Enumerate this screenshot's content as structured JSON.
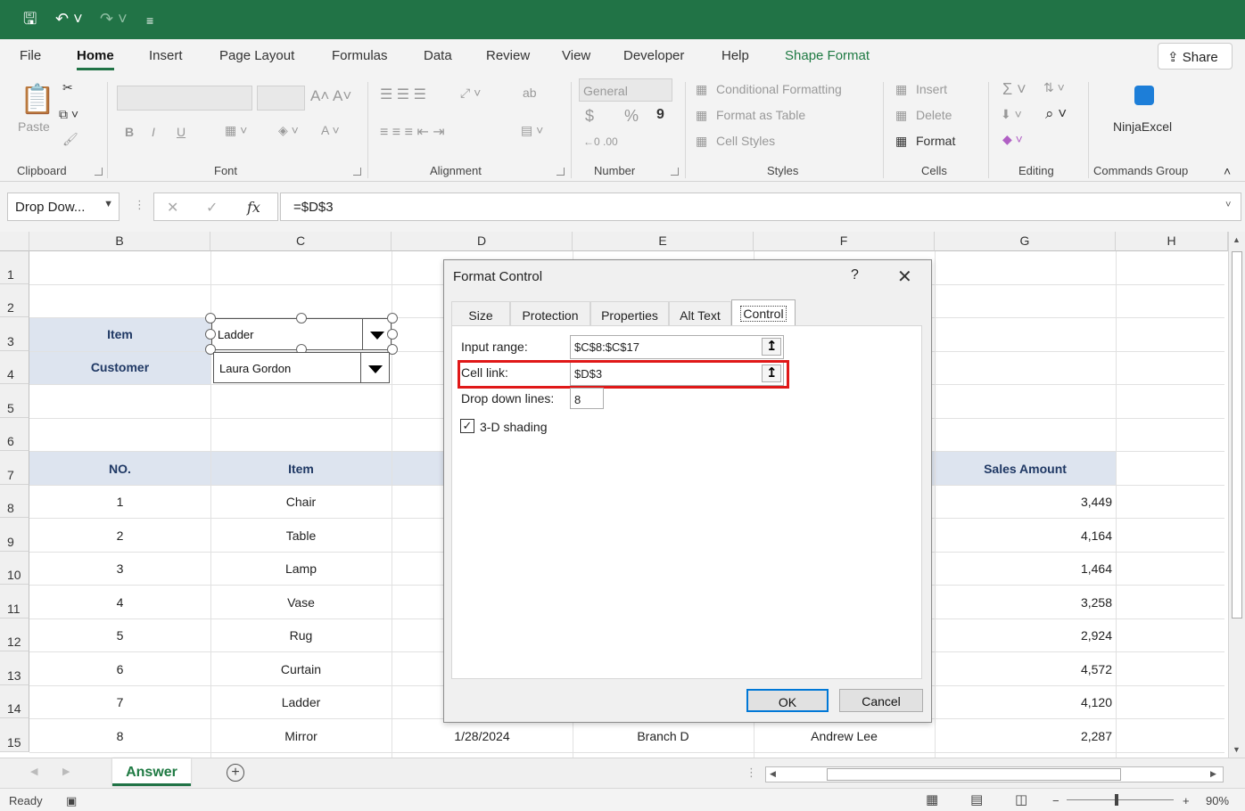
{
  "quick_access": {
    "save_icon": "save-icon",
    "undo_icon": "undo-icon",
    "redo_icon": "redo-icon",
    "customize_icon": "customize-icon"
  },
  "ribbon_tabs": [
    "File",
    "Home",
    "Insert",
    "Page Layout",
    "Formulas",
    "Data",
    "Review",
    "View",
    "Developer",
    "Help",
    "Shape Format"
  ],
  "share_label": "Share",
  "ribbon": {
    "clipboard": {
      "paste": "Paste",
      "label": "Clipboard"
    },
    "font": {
      "label": "Font",
      "bold": "B",
      "italic": "I",
      "underline": "U"
    },
    "alignment": {
      "label": "Alignment"
    },
    "number": {
      "format": "General",
      "currency": "$",
      "percent": "%",
      "comma": "9",
      "label": "Number"
    },
    "styles": {
      "conditional": "Conditional Formatting",
      "format_table": "Format as Table",
      "cell_styles": "Cell Styles",
      "label": "Styles"
    },
    "cells": {
      "insert": "Insert",
      "delete": "Delete",
      "format": "Format",
      "label": "Cells"
    },
    "editing": {
      "label": "Editing"
    },
    "commands": {
      "ninja": "NinjaExcel",
      "label": "Commands Group"
    }
  },
  "formula_bar": {
    "name_box": "Drop Dow...",
    "formula": "=$D$3",
    "fx": "fx"
  },
  "columns": [
    "B",
    "C",
    "D",
    "E",
    "F",
    "G",
    "H"
  ],
  "rows": [
    "1",
    "2",
    "3",
    "4",
    "5",
    "6",
    "7",
    "8",
    "9",
    "10",
    "11",
    "12",
    "13",
    "14",
    "15"
  ],
  "sheet": {
    "item_label": "Item",
    "customer_label": "Customer",
    "item_combo_value": "Ladder",
    "customer_combo_value": "Laura Gordon",
    "table_headers": {
      "no": "NO.",
      "item": "Item",
      "sales": "Sales Amount"
    },
    "table_rows": [
      {
        "no": "1",
        "item": "Chair",
        "sales": "3,449"
      },
      {
        "no": "2",
        "item": "Table",
        "sales": "4,164"
      },
      {
        "no": "3",
        "item": "Lamp",
        "sales": "1,464"
      },
      {
        "no": "4",
        "item": "Vase",
        "sales": "3,258"
      },
      {
        "no": "5",
        "item": "Rug",
        "sales": "2,924"
      },
      {
        "no": "6",
        "item": "Curtain",
        "sales": "4,572"
      },
      {
        "no": "7",
        "item": "Ladder",
        "sales": "4,120"
      },
      {
        "no": "8",
        "item": "Mirror",
        "sales": "2,287",
        "date": "1/28/2024",
        "branch": "Branch D",
        "customer": "Andrew Lee"
      }
    ]
  },
  "dialog": {
    "title": "Format Control",
    "help": "?",
    "close": "✕",
    "tabs": [
      "Size",
      "Protection",
      "Properties",
      "Alt Text",
      "Control"
    ],
    "input_range_label": "Input range:",
    "input_range_value": "$C$8:$C$17",
    "cell_link_label": "Cell link:",
    "cell_link_value": "$D$3",
    "drop_down_label": "Drop down lines:",
    "drop_down_value": "8",
    "shading_label": "3-D shading",
    "shading_checked": "✓",
    "ok": "OK",
    "cancel": "Cancel"
  },
  "sheet_tabs": {
    "active": "Answer",
    "add": "+"
  },
  "status": {
    "ready": "Ready",
    "zoom": "90%",
    "minus": "−",
    "plus": "+"
  }
}
